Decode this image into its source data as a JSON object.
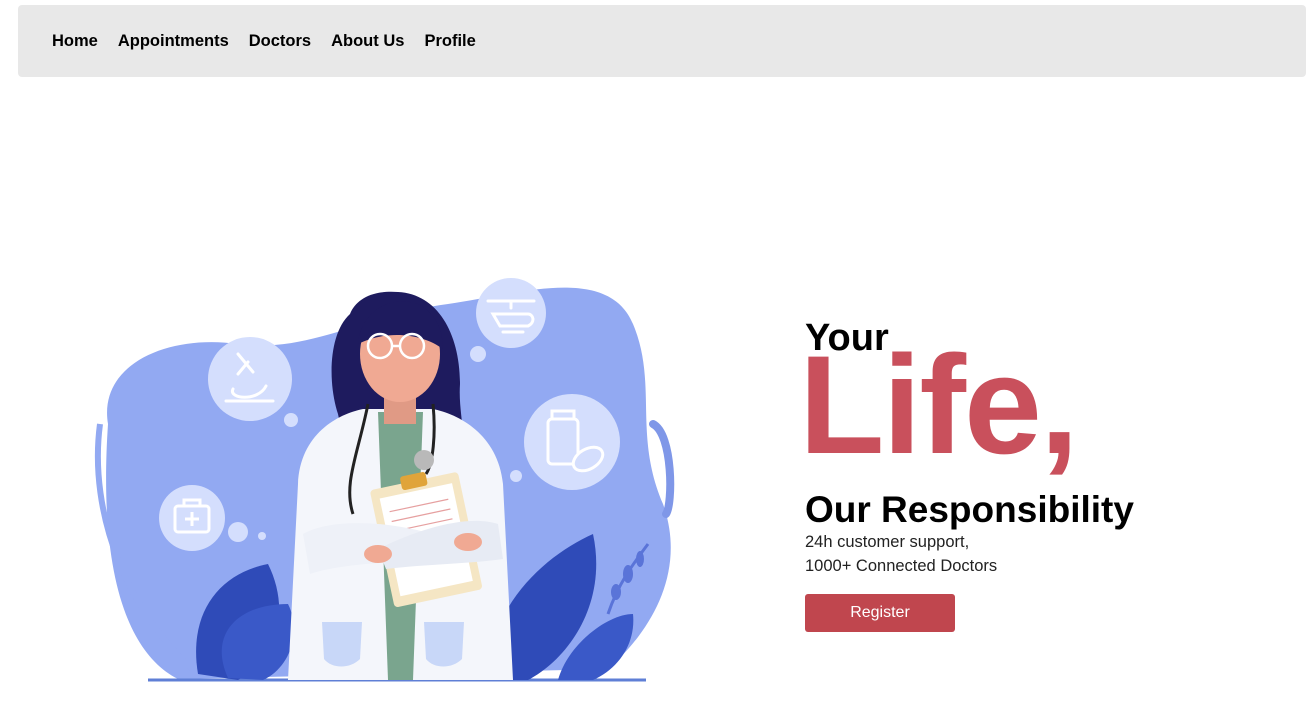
{
  "nav": {
    "items": [
      "Home",
      "Appointments",
      "Doctors",
      "About Us",
      "Profile"
    ]
  },
  "hero": {
    "line1": "Your",
    "line2": "Life,",
    "line3": "Our Responsibility",
    "sub1": "24h customer support,",
    "sub2": "1000+ Connected Doctors",
    "register_label": "Register",
    "accent_color": "#c9505c",
    "button_color": "#c0464e",
    "illustration": "doctor-illustration"
  },
  "icons": [
    "microscope-icon",
    "helicopter-icon",
    "medicine-bottle-icon",
    "first-aid-kit-icon"
  ]
}
